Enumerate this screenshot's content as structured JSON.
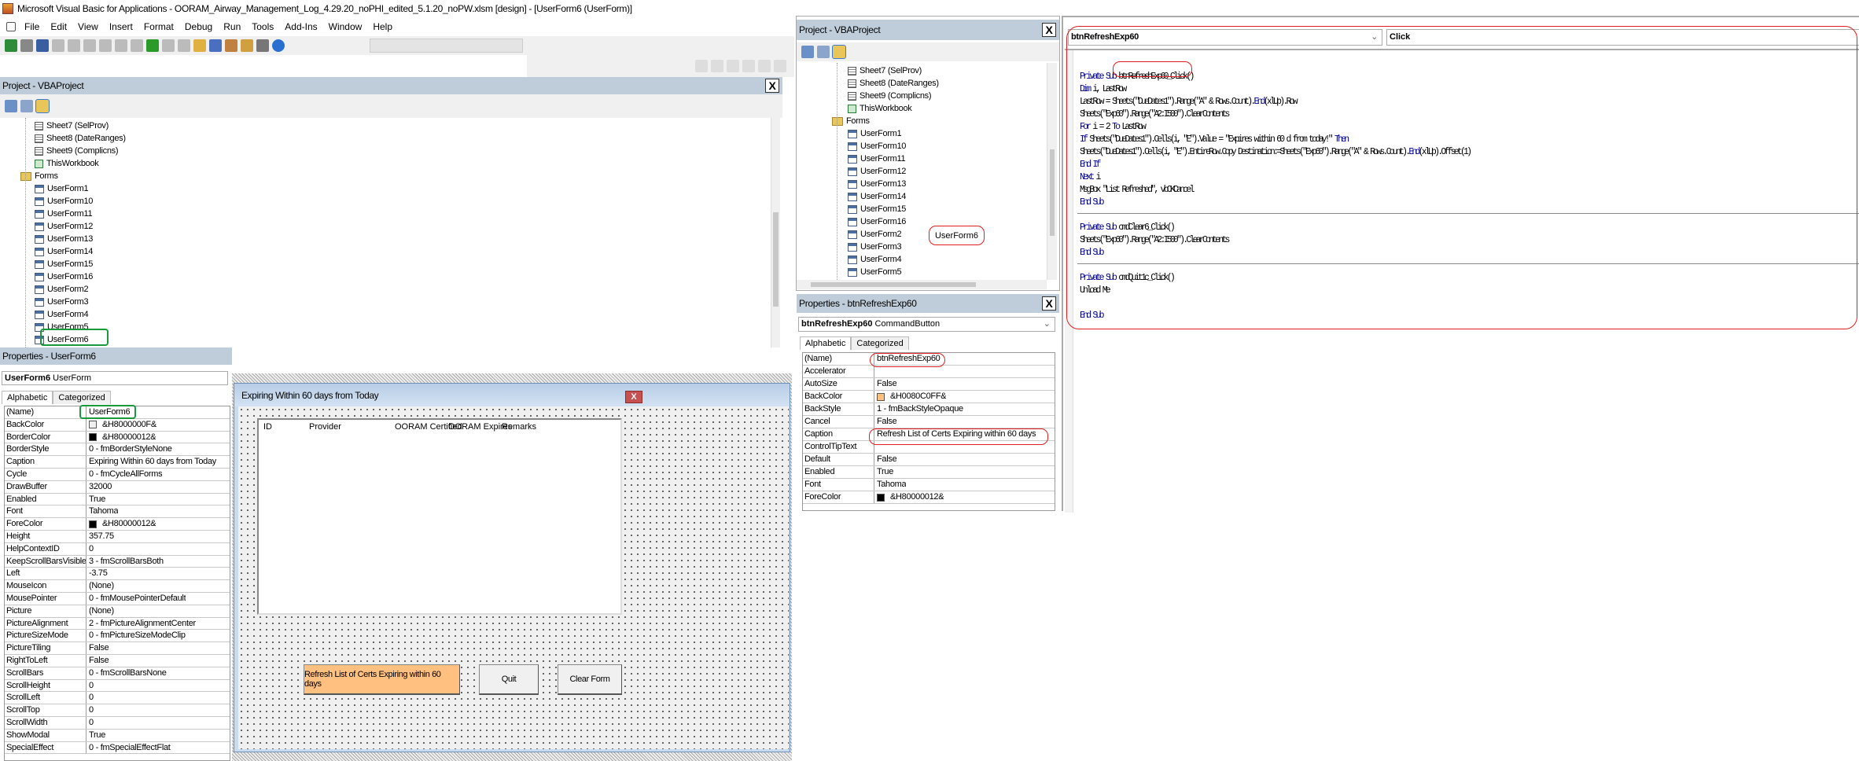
{
  "window": {
    "title": "Microsoft Visual Basic for Applications - OORAM_Airway_Management_Log_4.29.20_noPHI_edited_5.1.20_noPW.xlsm [design] - [UserForm6 (UserForm)]"
  },
  "menu": [
    "File",
    "Edit",
    "View",
    "Insert",
    "Format",
    "Debug",
    "Run",
    "Tools",
    "Add-Ins",
    "Window",
    "Help"
  ],
  "toolbar_icons": [
    "excel-icon",
    "insert-userform-icon",
    "save-icon",
    "cut-icon",
    "copy-icon",
    "paste-icon",
    "find-icon",
    "undo-icon",
    "redo-icon",
    "run-icon",
    "break-icon",
    "reset-icon",
    "design-mode-icon",
    "project-explorer-icon",
    "properties-icon",
    "object-browser-icon",
    "toolbox-icon",
    "help-icon"
  ],
  "project_left": {
    "title": "Project - VBAProject",
    "close": "X",
    "items": [
      {
        "label": "Sheet7 (SelProv)",
        "type": "sheet"
      },
      {
        "label": "Sheet8 (DateRanges)",
        "type": "sheet"
      },
      {
        "label": "Sheet9 (Complicns)",
        "type": "sheet"
      },
      {
        "label": "ThisWorkbook",
        "type": "workbook"
      },
      {
        "label": "Forms",
        "type": "folder"
      },
      {
        "label": "UserForm1",
        "type": "form"
      },
      {
        "label": "UserForm10",
        "type": "form"
      },
      {
        "label": "UserForm11",
        "type": "form"
      },
      {
        "label": "UserForm12",
        "type": "form"
      },
      {
        "label": "UserForm13",
        "type": "form"
      },
      {
        "label": "UserForm14",
        "type": "form"
      },
      {
        "label": "UserForm15",
        "type": "form"
      },
      {
        "label": "UserForm16",
        "type": "form"
      },
      {
        "label": "UserForm2",
        "type": "form"
      },
      {
        "label": "UserForm3",
        "type": "form"
      },
      {
        "label": "UserForm4",
        "type": "form"
      },
      {
        "label": "UserForm5",
        "type": "form"
      },
      {
        "label": "UserForm6",
        "type": "form",
        "selected": true
      }
    ]
  },
  "properties_left": {
    "title": "Properties - UserForm6",
    "object_name": "UserForm6",
    "object_type": "UserForm",
    "tabs": [
      "Alphabetic",
      "Categorized"
    ],
    "rows": [
      {
        "name": "(Name)",
        "value": "UserForm6"
      },
      {
        "name": "BackColor",
        "value": "&H8000000F&",
        "swatch": "#f0f0f0"
      },
      {
        "name": "BorderColor",
        "value": "&H80000012&",
        "swatch": "#000000"
      },
      {
        "name": "BorderStyle",
        "value": "0 - fmBorderStyleNone"
      },
      {
        "name": "Caption",
        "value": "Expiring Within 60 days from Today"
      },
      {
        "name": "Cycle",
        "value": "0 - fmCycleAllForms"
      },
      {
        "name": "DrawBuffer",
        "value": "32000"
      },
      {
        "name": "Enabled",
        "value": "True"
      },
      {
        "name": "Font",
        "value": "Tahoma"
      },
      {
        "name": "ForeColor",
        "value": "&H80000012&",
        "swatch": "#000000"
      },
      {
        "name": "Height",
        "value": "357.75"
      },
      {
        "name": "HelpContextID",
        "value": "0"
      },
      {
        "name": "KeepScrollBarsVisible",
        "value": "3 - fmScrollBarsBoth"
      },
      {
        "name": "Left",
        "value": "-3.75"
      },
      {
        "name": "MouseIcon",
        "value": "(None)"
      },
      {
        "name": "MousePointer",
        "value": "0 - fmMousePointerDefault"
      },
      {
        "name": "Picture",
        "value": "(None)"
      },
      {
        "name": "PictureAlignment",
        "value": "2 - fmPictureAlignmentCenter"
      },
      {
        "name": "PictureSizeMode",
        "value": "0 - fmPictureSizeModeClip"
      },
      {
        "name": "PictureTiling",
        "value": "False"
      },
      {
        "name": "RightToLeft",
        "value": "False"
      },
      {
        "name": "ScrollBars",
        "value": "0 - fmScrollBarsNone"
      },
      {
        "name": "ScrollHeight",
        "value": "0"
      },
      {
        "name": "ScrollLeft",
        "value": "0"
      },
      {
        "name": "ScrollTop",
        "value": "0"
      },
      {
        "name": "ScrollWidth",
        "value": "0"
      },
      {
        "name": "ShowModal",
        "value": "True"
      },
      {
        "name": "SpecialEffect",
        "value": "0 - fmSpecialEffectFlat"
      }
    ]
  },
  "userform": {
    "caption": "Expiring Within 60 days from Today",
    "close": "X",
    "list_headers": [
      "ID",
      "Provider",
      "OORAM Certified",
      "OORAM Expires",
      "Remarks"
    ],
    "refresh_button": "Refresh List of Certs Expiring within 60 days",
    "refresh_color": "#ffc080",
    "quit_button": "Quit",
    "clear_button": "Clear Form"
  },
  "project_right": {
    "title": "Project - VBAProject",
    "close": "X",
    "items": [
      {
        "label": "Sheet7 (SelProv)",
        "type": "sheet"
      },
      {
        "label": "Sheet8 (DateRanges)",
        "type": "sheet"
      },
      {
        "label": "Sheet9 (Complicns)",
        "type": "sheet"
      },
      {
        "label": "ThisWorkbook",
        "type": "workbook"
      },
      {
        "label": "Forms",
        "type": "folder"
      },
      {
        "label": "UserForm1",
        "type": "form"
      },
      {
        "label": "UserForm10",
        "type": "form"
      },
      {
        "label": "UserForm11",
        "type": "form"
      },
      {
        "label": "UserForm12",
        "type": "form"
      },
      {
        "label": "UserForm13",
        "type": "form"
      },
      {
        "label": "UserForm14",
        "type": "form"
      },
      {
        "label": "UserForm15",
        "type": "form"
      },
      {
        "label": "UserForm16",
        "type": "form"
      },
      {
        "label": "UserForm2",
        "type": "form"
      },
      {
        "label": "UserForm3",
        "type": "form"
      },
      {
        "label": "UserForm4",
        "type": "form"
      },
      {
        "label": "UserForm5",
        "type": "form"
      }
    ],
    "annotation": "UserForm6"
  },
  "properties_right": {
    "title": "Properties - btnRefreshExp60",
    "close": "X",
    "object_name": "btnRefreshExp60",
    "object_type": "CommandButton",
    "tabs": [
      "Alphabetic",
      "Categorized"
    ],
    "rows": [
      {
        "name": "(Name)",
        "value": "btnRefreshExp60"
      },
      {
        "name": "Accelerator",
        "value": ""
      },
      {
        "name": "AutoSize",
        "value": "False"
      },
      {
        "name": "BackColor",
        "value": "&H0080C0FF&",
        "swatch": "#ffc080"
      },
      {
        "name": "BackStyle",
        "value": "1 - fmBackStyleOpaque"
      },
      {
        "name": "Cancel",
        "value": "False"
      },
      {
        "name": "Caption",
        "value": "Refresh List of Certs Expiring within 60 days"
      },
      {
        "name": "ControlTipText",
        "value": ""
      },
      {
        "name": "Default",
        "value": "False"
      },
      {
        "name": "Enabled",
        "value": "True"
      },
      {
        "name": "Font",
        "value": "Tahoma"
      },
      {
        "name": "ForeColor",
        "value": "&H80000012&",
        "swatch": "#000000"
      }
    ]
  },
  "code": {
    "object": "btnRefreshExp60",
    "procedure": "Click",
    "lines": [
      "Private Sub btnRefreshExp60_Click()",
      "Dim i, LastRow",
      "LastRow = Sheets(\"DueDates1\").Range(\"A\" & Rows.Count).End(xlUp).Row",
      "Sheets(\"Exp60\").Range(\"A2:I500\").ClearContents",
      "For i = 2 To LastRow",
      "If Sheets(\"DueDates1\").Cells(i, \"E\").Value = \"Expires within 60 d from today!\" Then",
      "Sheets(\"DueDates1\").Cells(i, \"E\").EntireRow.Copy Destination:=Sheets(\"Exp60\").Range(\"A\" & Rows.Count).End(xlUp).Offset(1)",
      "End If",
      "Next i",
      "MsgBox \"List Refreshed\", vbOKCancel",
      "End Sub",
      "",
      "Private Sub cmdClear6_Click()",
      "Sheets(\"Exp60\").Range(\"A2:I500\").ClearContents",
      "End Sub",
      "",
      "Private Sub cmdQuit1c_Click()",
      "Unload Me",
      "",
      "End Sub"
    ]
  },
  "annotation_colors": {
    "red": "#e02020",
    "green": "#1a9a3a"
  }
}
